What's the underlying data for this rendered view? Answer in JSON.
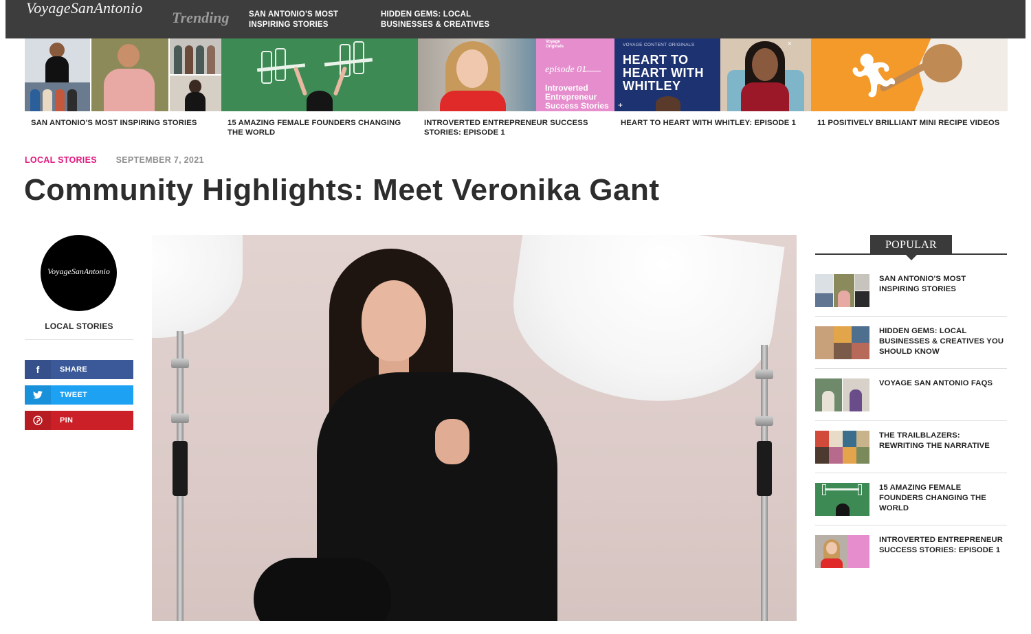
{
  "site": {
    "logo": "VoyageSanAntonio"
  },
  "topbar": {
    "trending_label": "Trending",
    "links": [
      "SAN ANTONIO'S MOST INSPIRING STORIES",
      "HIDDEN GEMS: LOCAL BUSINESSES & CREATIVES"
    ]
  },
  "trending_cards": [
    {
      "title": "SAN ANTONIO'S MOST INSPIRING STORIES"
    },
    {
      "title": "15 AMAZING FEMALE FOUNDERS CHANGING THE WORLD"
    },
    {
      "title": "INTROVERTED ENTREPRENEUR SUCCESS STORIES: EPISODE 1",
      "thumb_small": "Voyage Originals",
      "thumb_episode": "episode 01",
      "thumb_text": "Introverted Entrepreneur Success Stories"
    },
    {
      "title": "HEART TO HEART WITH WHITLEY: EPISODE 1",
      "thumb_tag": "VOYAGE CONTENT ORIGINALS",
      "thumb_text": "HEART TO HEART WITH WHITLEY"
    },
    {
      "title": "11 POSITIVELY BRILLIANT MINI RECIPE VIDEOS"
    }
  ],
  "article": {
    "category": "LOCAL STORIES",
    "date": "SEPTEMBER 7, 2021",
    "headline": "Community Highlights: Meet Veronika Gant"
  },
  "author": {
    "avatar_text": "VoyageSanAntonio",
    "category": "LOCAL STORIES"
  },
  "share": [
    {
      "label": "SHARE",
      "icon": "facebook-icon",
      "color": "#3b5998"
    },
    {
      "label": "TWEET",
      "icon": "twitter-icon",
      "color": "#1da1f2"
    },
    {
      "label": "PIN",
      "icon": "pinterest-icon",
      "color": "#cb2027"
    }
  ],
  "popular": {
    "heading": "POPULAR",
    "items": [
      "SAN ANTONIO'S MOST INSPIRING STORIES",
      "HIDDEN GEMS: LOCAL BUSINESSES & CREATIVES YOU SHOULD KNOW",
      "VOYAGE SAN ANTONIO FAQS",
      "THE TRAILBLAZERS: REWRITING THE NARRATIVE",
      "15 AMAZING FEMALE FOUNDERS CHANGING THE WORLD",
      "INTROVERTED ENTREPRENEUR SUCCESS STORIES: EPISODE 1"
    ]
  },
  "colors": {
    "topbar": "#3d3d3d",
    "category_accent": "#e0177d",
    "facebook": "#3b5998",
    "twitter": "#1da1f2",
    "pinterest": "#cb2027"
  }
}
